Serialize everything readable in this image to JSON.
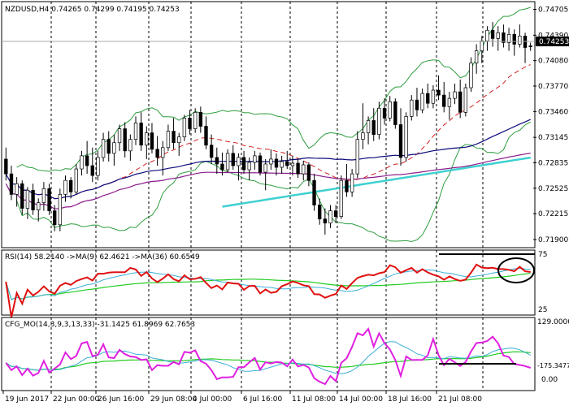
{
  "colors": {
    "background": "#ffffff",
    "frame": "#000000",
    "grid": "#000000",
    "bull_candle": "#ffffff",
    "bear_candle": "#000000",
    "bb": "#2f9e3f",
    "signal": "#d42020",
    "ma_navy": "#0a0a7a",
    "ma_purple": "#8b1a8b",
    "ma_cyan": "#3fd0d0",
    "rsi_main": "#e01010",
    "rsi_ma_fast": "#3aaed8",
    "rsi_ma_slow": "#22cc22",
    "mo_main": "#e020e0",
    "mo_fast": "#3aaed8",
    "mo_slow": "#22cc22",
    "annotation": "#000000"
  },
  "panels": {
    "price": {
      "label": "NZDUSD,H4  0.74265 0.74299 0.74195 0.74253",
      "y_ticks": [
        "0.74705",
        "0.74390",
        "0.74080",
        "0.73770",
        "0.73460",
        "0.73145",
        "0.72835",
        "0.72525",
        "0.72215",
        "0.71900"
      ],
      "current_price": "0.74253"
    },
    "rsi": {
      "label": "RSI(14) 58.2140  ->MA(9) 62.4621  ->MA(36) 60.6549",
      "y_ticks": [
        "75",
        "25"
      ]
    },
    "mo": {
      "label": "CFG_MO(14,3,9,3,13,33) -31.1425 61.8969 62.7653",
      "y_ticks": [
        "129.0000",
        "-175.3477",
        "0.00"
      ]
    }
  },
  "x_axis": {
    "labels": [
      "19 Jun 2017",
      "22 Jun 00:00",
      "26 Jun 16:00",
      "29 Jun 08:00",
      "4 Jul 00:00",
      "6 Jul 16:00",
      "11 Jul 08:00",
      "14 Jul 00:00",
      "18 Jul 16:00",
      "21 Jul 08:00"
    ]
  },
  "chart_data": [
    {
      "type": "candlestick",
      "symbol": "NZDUSD",
      "timeframe": "H4",
      "ohlc_last": {
        "open": 0.74265,
        "high": 0.74299,
        "low": 0.74195,
        "close": 0.74253
      },
      "ylim": [
        0.7185,
        0.7474
      ],
      "indicators": [
        "Bollinger Bands",
        "MA",
        "MA",
        "MA"
      ],
      "candles": [
        [
          0.7288,
          0.7302,
          0.7262,
          0.727
        ],
        [
          0.727,
          0.728,
          0.7238,
          0.7245
        ],
        [
          0.7245,
          0.7266,
          0.723,
          0.7258
        ],
        [
          0.7258,
          0.7262,
          0.722,
          0.7228
        ],
        [
          0.7228,
          0.7254,
          0.7215,
          0.725
        ],
        [
          0.725,
          0.7258,
          0.722,
          0.7226
        ],
        [
          0.7226,
          0.724,
          0.7212,
          0.7235
        ],
        [
          0.7235,
          0.726,
          0.7225,
          0.7252
        ],
        [
          0.7252,
          0.7258,
          0.722,
          0.7225
        ],
        [
          0.7225,
          0.7232,
          0.72,
          0.7208
        ],
        [
          0.7208,
          0.7252,
          0.72,
          0.7245
        ],
        [
          0.7245,
          0.7268,
          0.7236,
          0.7262
        ],
        [
          0.7262,
          0.7266,
          0.724,
          0.7248
        ],
        [
          0.7248,
          0.7282,
          0.7245,
          0.7276
        ],
        [
          0.7276,
          0.7298,
          0.7268,
          0.7292
        ],
        [
          0.7292,
          0.731,
          0.727,
          0.728
        ],
        [
          0.728,
          0.7302,
          0.726,
          0.7268
        ],
        [
          0.7268,
          0.7298,
          0.7262,
          0.729
        ],
        [
          0.729,
          0.732,
          0.7285,
          0.7312
        ],
        [
          0.7312,
          0.7322,
          0.7285,
          0.7295
        ],
        [
          0.7295,
          0.7318,
          0.728,
          0.7308
        ],
        [
          0.7308,
          0.733,
          0.7298,
          0.7325
        ],
        [
          0.7325,
          0.7333,
          0.729,
          0.7298
        ],
        [
          0.7298,
          0.7318,
          0.7286,
          0.7312
        ],
        [
          0.7312,
          0.734,
          0.7305,
          0.7332
        ],
        [
          0.7332,
          0.7345,
          0.7298,
          0.7305
        ],
        [
          0.7305,
          0.7328,
          0.7288,
          0.732
        ],
        [
          0.732,
          0.7332,
          0.7295,
          0.73
        ],
        [
          0.73,
          0.7316,
          0.728,
          0.729
        ],
        [
          0.729,
          0.731,
          0.7268,
          0.7302
        ],
        [
          0.7302,
          0.733,
          0.7298,
          0.7322
        ],
        [
          0.7322,
          0.7338,
          0.73,
          0.7308
        ],
        [
          0.7308,
          0.732,
          0.7292,
          0.7315
        ],
        [
          0.7315,
          0.7342,
          0.731,
          0.7338
        ],
        [
          0.7338,
          0.7348,
          0.7318,
          0.7325
        ],
        [
          0.7325,
          0.735,
          0.732,
          0.7345
        ],
        [
          0.7345,
          0.7352,
          0.732,
          0.7328
        ],
        [
          0.7328,
          0.734,
          0.73,
          0.7305
        ],
        [
          0.7305,
          0.7318,
          0.7282,
          0.729
        ],
        [
          0.729,
          0.7302,
          0.727,
          0.7282
        ],
        [
          0.7282,
          0.7296,
          0.7268,
          0.7275
        ],
        [
          0.7275,
          0.73,
          0.7272,
          0.7295
        ],
        [
          0.7295,
          0.7305,
          0.7275,
          0.728
        ],
        [
          0.728,
          0.7295,
          0.7262,
          0.729
        ],
        [
          0.729,
          0.7298,
          0.727,
          0.7275
        ],
        [
          0.7275,
          0.729,
          0.7262,
          0.7284
        ],
        [
          0.7284,
          0.7298,
          0.7275,
          0.7292
        ],
        [
          0.7292,
          0.7296,
          0.7268,
          0.7272
        ],
        [
          0.7272,
          0.7288,
          0.725,
          0.7282
        ],
        [
          0.7282,
          0.73,
          0.7275,
          0.7288
        ],
        [
          0.7288,
          0.7295,
          0.7268,
          0.7278
        ],
        [
          0.7278,
          0.7292,
          0.727,
          0.7285
        ],
        [
          0.7285,
          0.7298,
          0.7276,
          0.728
        ],
        [
          0.728,
          0.7292,
          0.7268,
          0.7283
        ],
        [
          0.7283,
          0.7288,
          0.7265,
          0.727
        ],
        [
          0.727,
          0.7286,
          0.7262,
          0.7281
        ],
        [
          0.7281,
          0.7284,
          0.7255,
          0.7262
        ],
        [
          0.7262,
          0.727,
          0.7225,
          0.7232
        ],
        [
          0.7232,
          0.724,
          0.7208,
          0.7215
        ],
        [
          0.7215,
          0.7228,
          0.7196,
          0.721
        ],
        [
          0.721,
          0.7232,
          0.7204,
          0.7225
        ],
        [
          0.7225,
          0.7232,
          0.721,
          0.7218
        ],
        [
          0.7218,
          0.7268,
          0.7215,
          0.7262
        ],
        [
          0.7262,
          0.7282,
          0.7242,
          0.7248
        ],
        [
          0.7248,
          0.7276,
          0.7242,
          0.727
        ],
        [
          0.727,
          0.7322,
          0.7265,
          0.7312
        ],
        [
          0.7312,
          0.7356,
          0.73,
          0.732
        ],
        [
          0.732,
          0.734,
          0.7306,
          0.7335
        ],
        [
          0.7335,
          0.735,
          0.731,
          0.7318
        ],
        [
          0.7318,
          0.7358,
          0.7312,
          0.735
        ],
        [
          0.735,
          0.7362,
          0.733,
          0.7338
        ],
        [
          0.7338,
          0.7365,
          0.7334,
          0.7358
        ],
        [
          0.7358,
          0.7362,
          0.7325,
          0.733
        ],
        [
          0.733,
          0.735,
          0.728,
          0.729
        ],
        [
          0.729,
          0.7345,
          0.7285,
          0.734
        ],
        [
          0.734,
          0.7366,
          0.7335,
          0.736
        ],
        [
          0.736,
          0.7375,
          0.734,
          0.7348
        ],
        [
          0.7348,
          0.7374,
          0.7344,
          0.7368
        ],
        [
          0.7368,
          0.738,
          0.735,
          0.7356
        ],
        [
          0.7356,
          0.7378,
          0.735,
          0.7372
        ],
        [
          0.7372,
          0.739,
          0.736,
          0.7366
        ],
        [
          0.7366,
          0.7382,
          0.7345,
          0.7352
        ],
        [
          0.7352,
          0.737,
          0.7336,
          0.7362
        ],
        [
          0.7362,
          0.738,
          0.7355,
          0.737
        ],
        [
          0.737,
          0.7385,
          0.7338,
          0.7345
        ],
        [
          0.7345,
          0.738,
          0.734,
          0.7375
        ],
        [
          0.7375,
          0.7412,
          0.737,
          0.7405
        ],
        [
          0.7405,
          0.7428,
          0.7392,
          0.742
        ],
        [
          0.742,
          0.7438,
          0.7405,
          0.7432
        ],
        [
          0.7432,
          0.745,
          0.742,
          0.7445
        ],
        [
          0.7445,
          0.7455,
          0.7425,
          0.7435
        ],
        [
          0.7435,
          0.745,
          0.742,
          0.7442
        ],
        [
          0.7442,
          0.7452,
          0.7424,
          0.743
        ],
        [
          0.743,
          0.7448,
          0.742,
          0.744
        ],
        [
          0.744,
          0.7446,
          0.7414,
          0.7428
        ],
        [
          0.7428,
          0.7452,
          0.7424,
          0.7438
        ],
        [
          0.7438,
          0.7442,
          0.7405,
          0.7424
        ],
        [
          0.7426,
          0.743,
          0.742,
          0.7425
        ]
      ]
    },
    {
      "type": "line",
      "name": "RSI",
      "params": [
        14
      ],
      "ylim": [
        0,
        100
      ],
      "levels": [
        75,
        25
      ],
      "values": [
        58.214,
        62.4621,
        60.6549
      ]
    },
    {
      "type": "line",
      "name": "CFG_MO",
      "params": [
        14,
        3,
        9,
        3,
        13,
        33
      ],
      "levels": [
        129.0,
        -175.3477,
        0.0
      ],
      "values": [
        -31.1425,
        61.8969,
        62.7653
      ]
    }
  ]
}
